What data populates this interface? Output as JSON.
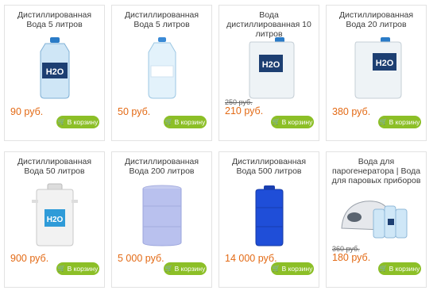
{
  "products": [
    {
      "title": "Дистиллированная Вода 5 литров",
      "price": "90 руб.",
      "old_price": "",
      "cart_label": "В корзину",
      "icon": "cart-icon",
      "image": "bottle-5l-dark-label"
    },
    {
      "title": "Дистиллированная Вода 5 литров",
      "price": "50 руб.",
      "old_price": "",
      "cart_label": "В корзину",
      "icon": "cart-icon",
      "image": "bottle-5l-clear"
    },
    {
      "title": "Вода дистиллированная 10 литров",
      "price": "210 руб.",
      "old_price": "250 руб.",
      "cart_label": "В корзину",
      "icon": "cart-icon",
      "image": "canister-10l"
    },
    {
      "title": "Дистиллированная Вода 20 литров",
      "price": "380 руб.",
      "old_price": "",
      "cart_label": "В корзину",
      "icon": "cart-icon",
      "image": "canister-20l"
    },
    {
      "title": "Дистиллированная Вода 50 литров",
      "price": "900 руб.",
      "old_price": "",
      "cart_label": "В корзину",
      "icon": "cart-icon",
      "image": "barrel-50l"
    },
    {
      "title": "Дистиллированная Вода 200 литров",
      "price": "5 000 руб.",
      "old_price": "",
      "cart_label": "В корзину",
      "icon": "cart-icon",
      "image": "drum-200l"
    },
    {
      "title": "Дистиллированная Вода 500 литров",
      "price": "14 000 руб.",
      "old_price": "",
      "cart_label": "В корзину",
      "icon": "cart-icon",
      "image": "tank-500l"
    },
    {
      "title": "Вода для парогенератора | Вода для паровых приборов",
      "price": "180 руб.",
      "old_price": "360 руб.",
      "cart_label": "В корзину",
      "icon": "cart-icon",
      "image": "steam-generator-bottles"
    }
  ],
  "logo_text": "H2O",
  "colors": {
    "price": "#e36a15",
    "cart_button": "#8cbf27",
    "border": "#e2e2e2"
  }
}
